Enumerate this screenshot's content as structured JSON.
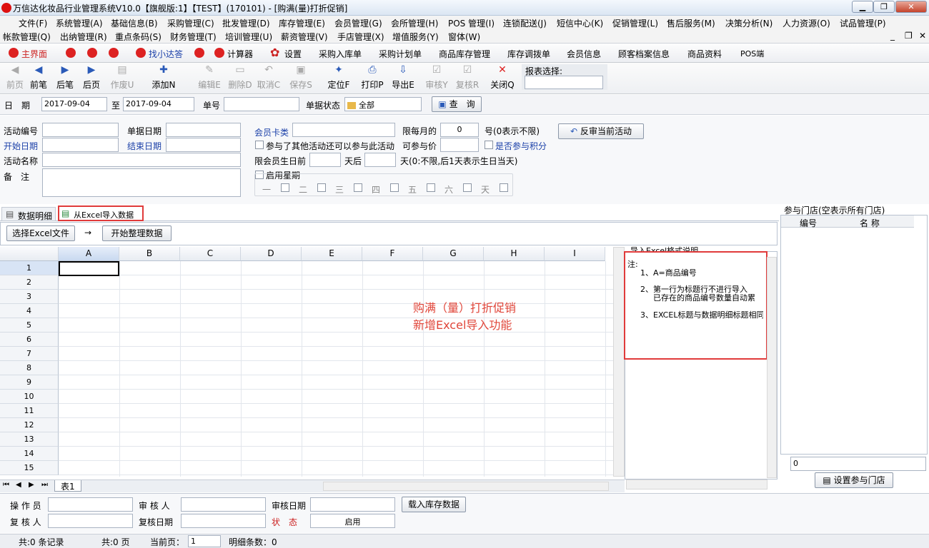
{
  "window": {
    "title": "万信达化妆品行业管理系统V10.0【旗舰版:1】【TEST】(170101) - [购满(量)打折促销]"
  },
  "menu1": [
    "文件(F)",
    "系统管理(A)",
    "基础信息(B)",
    "采购管理(C)",
    "批发管理(D)",
    "库存管理(E)",
    "会员管理(G)",
    "会所管理(H)",
    "POS 管理(I)",
    "连锁配送(J)",
    "短信中心(K)",
    "促销管理(L)",
    "售后服务(M)",
    "决策分析(N)",
    "人力资源(O)",
    "试品管理(P)"
  ],
  "menu2": [
    "帐款管理(Q)",
    "出纳管理(R)",
    "重点条码(S)",
    "财务管理(T)",
    "培训管理(U)",
    "薪资管理(V)",
    "手店管理(X)",
    "增值服务(Y)",
    "窗体(W)"
  ],
  "quick": {
    "home": "主界面",
    "find": "找小达答",
    "calc": "计算器",
    "settings": "设置",
    "links": [
      "采购入库单",
      "采购计划单",
      "商品库存管理",
      "库存调拨单",
      "会员信息",
      "顾客档案信息",
      "商品资料",
      "POS端"
    ]
  },
  "toolbar": {
    "buttons": [
      {
        "label": "前页",
        "icon": "◀"
      },
      {
        "label": "前笔",
        "icon": "◀"
      },
      {
        "label": "后笔",
        "icon": "▶"
      },
      {
        "label": "后页",
        "icon": "▶"
      },
      {
        "label": "作废U",
        "icon": "▤"
      },
      {
        "label": "添加N",
        "icon": "✚"
      },
      {
        "label": "编辑E",
        "icon": "✎"
      },
      {
        "label": "删除D",
        "icon": "▭"
      },
      {
        "label": "取消C",
        "icon": "↶"
      },
      {
        "label": "保存S",
        "icon": "▣"
      },
      {
        "label": "定位F",
        "icon": "✦"
      },
      {
        "label": "打印P",
        "icon": "⎙"
      },
      {
        "label": "导出E",
        "icon": "⇩"
      },
      {
        "label": "审核Y",
        "icon": "☑"
      },
      {
        "label": "复核R",
        "icon": "☑"
      },
      {
        "label": "关闭Q",
        "icon": "✕"
      }
    ],
    "report_label": "报表选择:"
  },
  "filter": {
    "date_label": "日　期",
    "date_from": "2017-09-04",
    "to_label": "至",
    "date_to": "2017-09-04",
    "doc_no_label": "单号",
    "status_label": "单据状态",
    "status_value": "全部",
    "query_label": "查　询"
  },
  "form": {
    "activity_no": "活动编号",
    "doc_date": "单据日期",
    "member_card": "会员卡类",
    "monthly_limit": "限每月的",
    "monthly_value": "0",
    "monthly_suffix": "号(0表示不限)",
    "revert_btn": "反审当前活动",
    "start_date": "开始日期",
    "end_date": "结束日期",
    "join_other": "参与了其他活动还可以参与此活动",
    "join_price": "可参与价",
    "join_points": "是否参与积分",
    "activity_name": "活动名称",
    "birthday_limit": "限会员生日前",
    "days_after": "天后",
    "days_suffix": "天(0:不限,后1天表示生日当天)",
    "remark": "备　注",
    "enable_week": "启用星期",
    "weekdays": [
      "一",
      "二",
      "三",
      "四",
      "五",
      "六",
      "天"
    ]
  },
  "tabs": {
    "detail": "数据明细",
    "excel": "从Excel导入数据"
  },
  "excel": {
    "choose_btn": "选择Excel文件",
    "arrow": "→",
    "start_btn": "开始整理数据"
  },
  "grid": {
    "columns": [
      "A",
      "B",
      "C",
      "D",
      "E",
      "F",
      "G",
      "H",
      "I"
    ],
    "rows": [
      "1",
      "2",
      "3",
      "4",
      "5",
      "6",
      "7",
      "8",
      "9",
      "10",
      "11",
      "12",
      "13",
      "14",
      "15"
    ],
    "sheet": "表1"
  },
  "annotation": {
    "line1": "购满（量）打折促销",
    "line2": "新增Excel导入功能"
  },
  "help": {
    "title": "导入Excel格式说明",
    "note": "注:",
    "items": [
      "1、A=商品编号",
      "2、第一行为标题行不进行导入",
      "已存在的商品编号数量自动累",
      "3、EXCEL标题与数据明细标题相同"
    ]
  },
  "stores": {
    "title": "参与门店(空表示所有门店)",
    "col_no": "编号",
    "col_name": "名 称",
    "count": "0",
    "set_btn": "设置参与门店"
  },
  "bottom": {
    "operator": "操 作 员",
    "auditor": "审 核 人",
    "audit_date": "审核日期",
    "load_btn": "载入库存数据",
    "rechecker": "复 核 人",
    "recheck_date": "复核日期",
    "status_label": "状　态",
    "status_value": "启用"
  },
  "statusbar": {
    "records": "共:0 条记录",
    "pages": "共:0 页",
    "cur_page_label": "当前页：",
    "cur_page": "1",
    "detail_count": "明细条数：0"
  }
}
